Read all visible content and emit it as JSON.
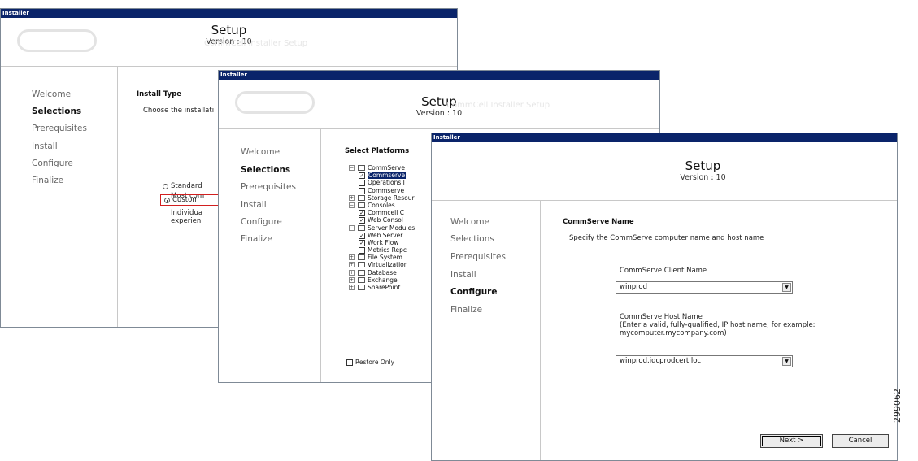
{
  "figure_id": "299062",
  "window1": {
    "title": "Installer",
    "header": {
      "title": "Setup",
      "version": "Version : 10",
      "ghost_text": "CommCell Installer Setup"
    },
    "nav": [
      "Welcome",
      "Selections",
      "Prerequisites",
      "Install",
      "Configure",
      "Finalize"
    ],
    "active_nav": "Selections",
    "section_title": "Install Type",
    "instruction": "Choose the installati",
    "options": [
      {
        "label": "Standard",
        "desc": "Most com",
        "selected": false
      },
      {
        "label": "Custom",
        "desc1": "Individua",
        "desc2": "experien",
        "selected": true
      }
    ]
  },
  "window2": {
    "title": "Installer",
    "header": {
      "title": "Setup",
      "version": "Version : 10",
      "ghost_text": "CommCell Installer Setup"
    },
    "nav": [
      "Welcome",
      "Selections",
      "Prerequisites",
      "Install",
      "Configure",
      "Finalize"
    ],
    "active_nav": "Selections",
    "section_title": "Select Platforms",
    "tree": [
      {
        "label": "CommServe",
        "level": 0,
        "expander": "minus",
        "checkbox": null
      },
      {
        "label": "Commserve",
        "level": 1,
        "expander": null,
        "checkbox": true,
        "highlighted": true
      },
      {
        "label": "Operations I",
        "level": 1,
        "expander": null,
        "checkbox": false
      },
      {
        "label": "Commserve",
        "level": 1,
        "expander": null,
        "checkbox": false
      },
      {
        "label": "Storage Resour",
        "level": 0,
        "expander": "plus",
        "checkbox": null
      },
      {
        "label": "Consoles",
        "level": 0,
        "expander": "minus",
        "checkbox": null
      },
      {
        "label": "Commcell C",
        "level": 1,
        "expander": null,
        "checkbox": true
      },
      {
        "label": "Web Consol",
        "level": 1,
        "expander": null,
        "checkbox": true
      },
      {
        "label": "Server Modules",
        "level": 0,
        "expander": "minus",
        "checkbox": null
      },
      {
        "label": "Web Server",
        "level": 1,
        "expander": null,
        "checkbox": true
      },
      {
        "label": "Work Flow",
        "level": 1,
        "expander": null,
        "checkbox": true
      },
      {
        "label": "Metrics Repc",
        "level": 1,
        "expander": null,
        "checkbox": false
      },
      {
        "label": "File System",
        "level": 0,
        "expander": "plus",
        "checkbox": null
      },
      {
        "label": "Virtualization",
        "level": 0,
        "expander": "plus",
        "checkbox": null
      },
      {
        "label": "Database",
        "level": 0,
        "expander": "plus",
        "checkbox": null
      },
      {
        "label": "Exchange",
        "level": 0,
        "expander": "plus",
        "checkbox": null
      },
      {
        "label": "SharePoint",
        "level": 0,
        "expander": "plus",
        "checkbox": null
      }
    ],
    "restore_only": {
      "label": "Restore Only",
      "checked": false
    }
  },
  "window3": {
    "title": "Installer",
    "header": {
      "title": "Setup",
      "version": "Version : 10"
    },
    "nav": [
      "Welcome",
      "Selections",
      "Prerequisites",
      "Install",
      "Configure",
      "Finalize"
    ],
    "active_nav": "Configure",
    "section_title": "CommServe Name",
    "instruction": "Specify the CommServe computer name and host name",
    "client_name_label": "CommServe Client Name",
    "client_name_value": "winprod",
    "host_name_label": "CommServe Host Name",
    "host_name_hint1": "(Enter a valid, fully-qualified, IP host name; for example:",
    "host_name_hint2": "mycomputer.mycompany.com)",
    "host_name_value": "winprod.idcprodcert.loc",
    "next_label": "Next >",
    "cancel_label": "Cancel"
  }
}
